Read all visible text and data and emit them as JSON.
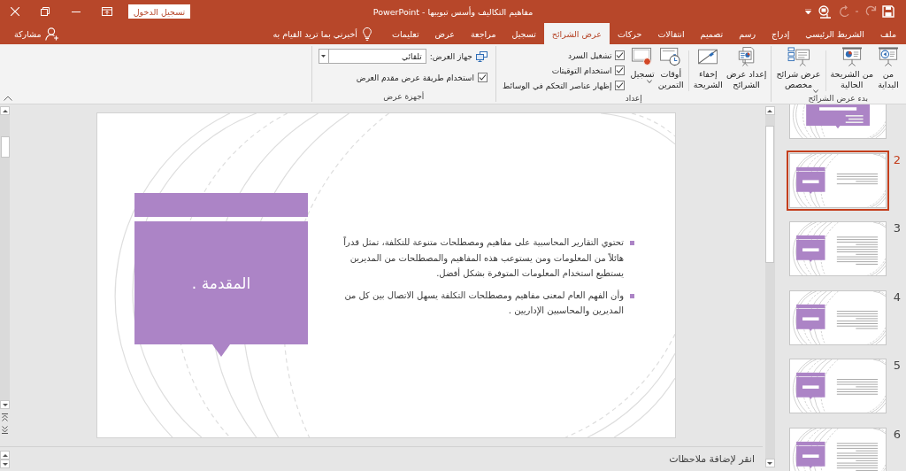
{
  "title_bar": {
    "quick_access": [
      {
        "kind": "save",
        "disabled": false
      },
      {
        "kind": "undo",
        "disabled": true
      },
      {
        "kind": "repeat",
        "disabled": true
      },
      {
        "kind": "present",
        "disabled": false
      },
      {
        "kind": "customize",
        "disabled": false
      }
    ],
    "document_title": "مفاهيم التكاليف وأسس تبويبها - PowerPoint",
    "sign_in": "تسجيل الدخول"
  },
  "tabs": [
    {
      "label": "ملف",
      "selected": false
    },
    {
      "label": "الشريط الرئيسي",
      "selected": false
    },
    {
      "label": "إدراج",
      "selected": false
    },
    {
      "label": "رسم",
      "selected": false
    },
    {
      "label": "تصميم",
      "selected": false
    },
    {
      "label": "انتقالات",
      "selected": false
    },
    {
      "label": "حركات",
      "selected": false
    },
    {
      "label": "عرض الشرائح",
      "selected": true
    },
    {
      "label": "تسجيل",
      "selected": false
    },
    {
      "label": "مراجعة",
      "selected": false
    },
    {
      "label": "عرض",
      "selected": false
    },
    {
      "label": "تعليمات",
      "selected": false
    }
  ],
  "tell_me": "أخبرني بما تريد القيام به",
  "share": "مشاركة",
  "ribbon": {
    "groups": [
      {
        "label": "بدء عرض الشرائح",
        "buttons": [
          {
            "label": "من\nالبداية",
            "dropdown": false
          },
          {
            "label": "من الشريحة\nالحالية",
            "dropdown": false
          },
          {
            "label": "عرض شرائح\nمخصص",
            "dropdown": true
          }
        ]
      },
      {
        "label": "إعداد",
        "buttons": [
          {
            "label": "إعداد عرض\nالشرائح",
            "dropdown": false
          },
          {
            "label": "إخفاء\nالشريحة",
            "dropdown": false
          },
          {
            "label": "أوقات\nالتمرين",
            "dropdown": false
          },
          {
            "label": "تسجيل",
            "dropdown": true
          }
        ],
        "checkboxes": [
          {
            "label": "تشغيل السرد",
            "checked": true
          },
          {
            "label": "استخدام التوقيتات",
            "checked": true
          },
          {
            "label": "إظهار عناصر التحكم في الوسائط",
            "checked": true
          }
        ]
      },
      {
        "label": "أجهزة عرض",
        "monitor": {
          "label": "جهاز العرض:",
          "value": "تلقائي"
        },
        "checkboxes": [
          {
            "label": "استخدام طريقة عرض مقدم العرض",
            "checked": true
          }
        ]
      }
    ]
  },
  "slide": {
    "title": "المقدمة .",
    "bullets": [
      "تحتوي التقارير المحاسبية على مفاهيم ومصطلحات متنوعة للتكلفة، تمثل قدراً هائلاً من المعلومات ومن يستوعب هذه المفاهيم والمصطلحات من المديرين يستطيع استخدام المعلومات المتوفرة بشكل أفضل.",
      "وأن الفهم العام لمعنى مفاهيم ومصطلحات التكلفة يسهل الاتصال بين كل من المديرين والمحاسبين الإداريين ."
    ]
  },
  "thumbnails": [
    {
      "selected": false
    },
    {
      "number": "2",
      "selected": true
    },
    {
      "number": "3",
      "selected": false
    },
    {
      "number": "4",
      "selected": false
    },
    {
      "number": "5",
      "selected": false
    },
    {
      "number": "6",
      "selected": false
    }
  ],
  "notes": {
    "placeholder": "انقر لإضافة ملاحظات"
  }
}
